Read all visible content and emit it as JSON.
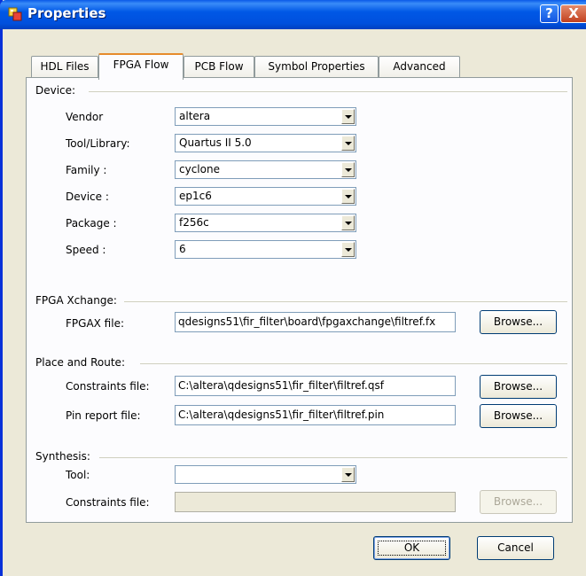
{
  "window": {
    "title": "Properties"
  },
  "titlebar": {
    "help_label": "?",
    "close_label": "X"
  },
  "tabs": [
    {
      "label": "HDL Files"
    },
    {
      "label": "FPGA Flow"
    },
    {
      "label": "PCB Flow"
    },
    {
      "label": "Symbol Properties"
    },
    {
      "label": "Advanced"
    }
  ],
  "device": {
    "heading": "Device:",
    "vendor_label": "Vendor",
    "vendor_value": "altera",
    "tool_library_label": "Tool/Library:",
    "tool_library_value": "Quartus II 5.0",
    "family_label": "Family :",
    "family_value": "cyclone",
    "device_label": "Device :",
    "device_value": "ep1c6",
    "package_label": "Package :",
    "package_value": "f256c",
    "speed_label": "Speed :",
    "speed_value": "6"
  },
  "fpga_xchange": {
    "heading": "FPGA Xchange:",
    "fpgax_label": "FPGAX file:",
    "fpgax_value": "qdesigns51\\fir_filter\\board\\fpgaxchange\\filtref.fx",
    "browse_label": "Browse..."
  },
  "place_route": {
    "heading": "Place and Route:",
    "constraints_label": "Constraints file:",
    "constraints_value": "C:\\altera\\qdesigns51\\fir_filter\\filtref.qsf",
    "pin_report_label": "Pin report file:",
    "pin_report_value": "C:\\altera\\qdesigns51\\fir_filter\\filtref.pin",
    "browse_label": "Browse..."
  },
  "synthesis": {
    "heading": "Synthesis:",
    "tool_label": "Tool:",
    "tool_value": "",
    "constraints_label": "Constraints file:",
    "constraints_value": "",
    "browse_label": "Browse..."
  },
  "footer": {
    "ok_label": "OK",
    "cancel_label": "Cancel"
  }
}
